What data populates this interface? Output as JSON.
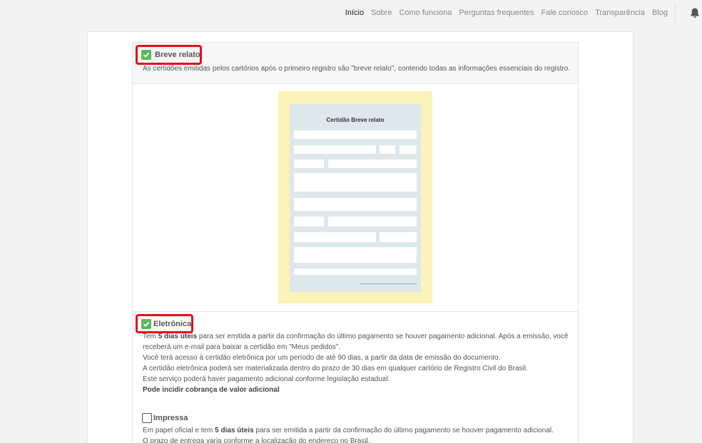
{
  "nav": {
    "items": [
      "Início",
      "Sobre",
      "Como funciona",
      "Perguntas frequentes",
      "Fale conosco",
      "Transparência",
      "Blog"
    ],
    "active": "Início"
  },
  "breve": {
    "title": "Breve relato",
    "description": "As certidões emitidas pelos cartórios após o primeiro registro são \"breve relato\", contendo todas as informações essenciais do registro."
  },
  "certificate": {
    "title": "Certidão Breve relato"
  },
  "eletronica": {
    "title": "Eletrônica",
    "line1_pre": "Tem ",
    "line1_bold": "5 dias úteis",
    "line1_post": " para ser emitida a partir da confirmação do último pagamento se houver pagamento adicional. Após a emissão, você",
    "line2": "receberá um e-mail para baixar a certidão em \"Meus pedidos\".",
    "line3": "Você terá acesso à certidão eletrônica por um período de até 90 dias, a partir da data de emissão do documento.",
    "line4": "A certidão eletrônica poderá ser materializada dentro do prazo de 30 dias em qualquer cartório de Registro Civil do Brasil.",
    "line5": "Este serviço poderá haver pagamento adicional conforme legislação estadual:",
    "line6": "Pode incidir cobrança de valor adicional"
  },
  "impressa": {
    "title": "Impressa",
    "line1_pre": "Em papel oficial e tem ",
    "line1_bold": "5 dias úteis",
    "line1_post": " para ser emitida a partir da confirmação do último pagamento se houver pagamento adicional.",
    "line2": "O prazo de entrega varia conforme a localização do endereço no Brasil."
  },
  "icons": {
    "bell": "bell-icon",
    "check": "check-icon"
  },
  "colors": {
    "check_green": "#5cb85c",
    "highlight_red": "#e0121b",
    "cert_yellow": "#fbf3b8",
    "cert_blue": "#dde7ec"
  }
}
